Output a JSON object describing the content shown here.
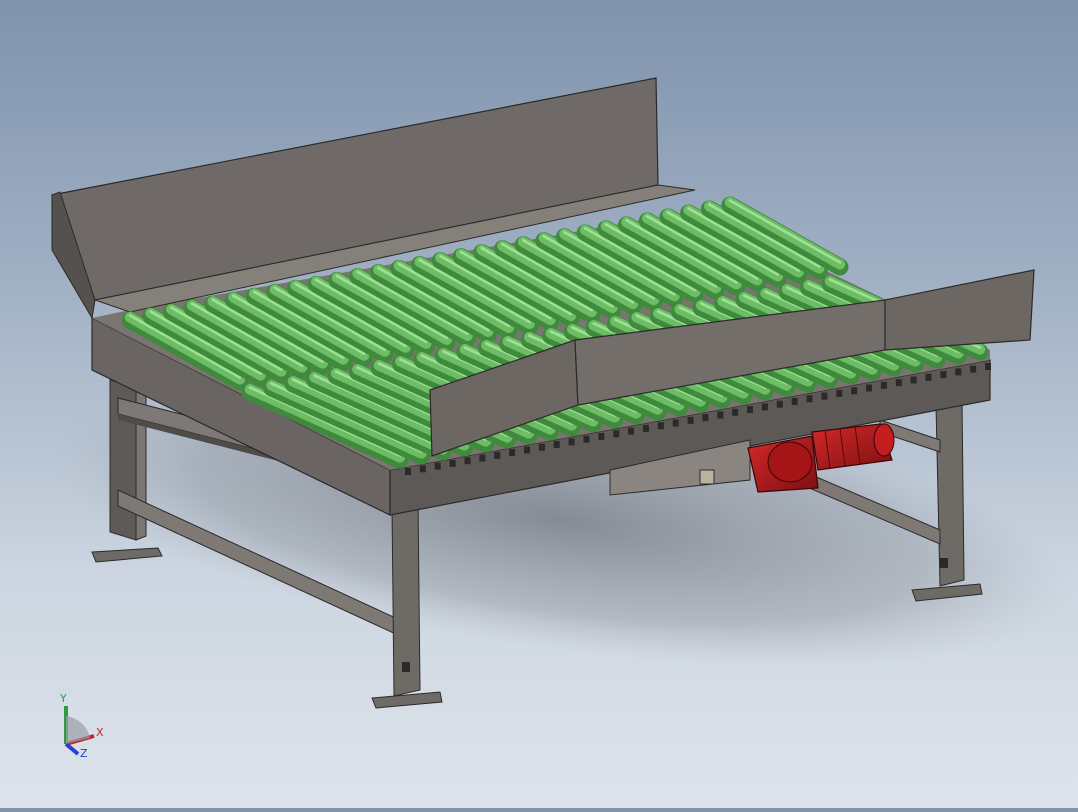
{
  "viewport": {
    "model": "roller-conveyor-assembly",
    "colors": {
      "frame": "#6e6a66",
      "frame_dark": "#4a4644",
      "frame_light": "#8a8581",
      "roller": "#5fae5a",
      "roller_dark": "#3f8a3c",
      "roller_light": "#8fd387",
      "motor": "#b3191b",
      "motor_dark": "#7d0f11",
      "shadow": "#8d939b"
    }
  },
  "triad": {
    "x_label": "X",
    "y_label": "Y",
    "z_label": "Z",
    "x_color": "#c0272d",
    "y_color": "#2f9a41",
    "z_color": "#2a3fc9"
  }
}
